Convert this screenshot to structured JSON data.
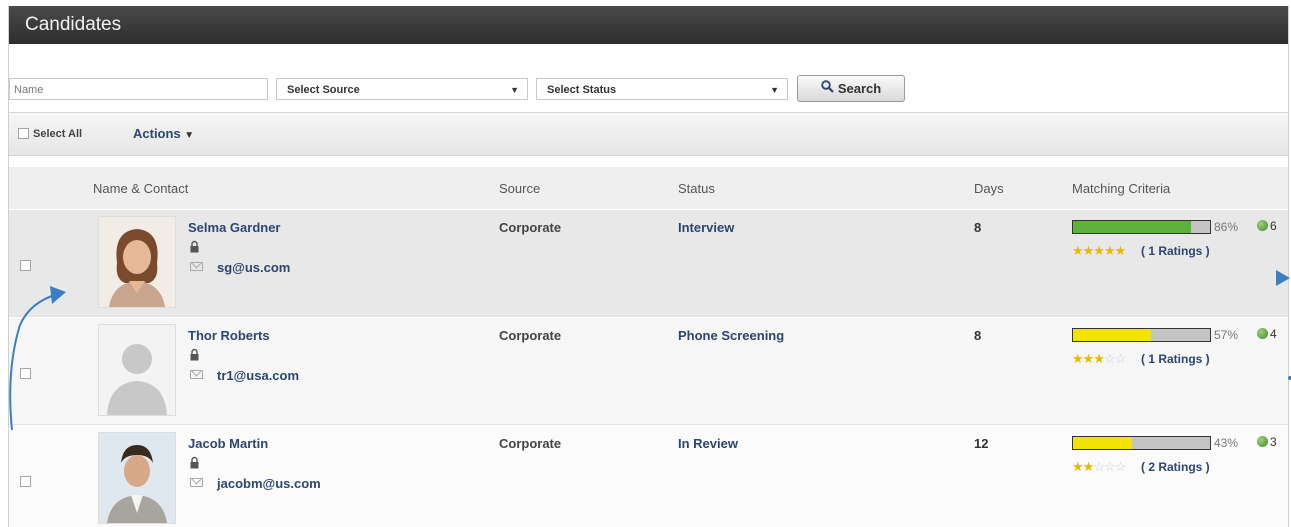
{
  "window": {
    "title": "Candidates"
  },
  "filters": {
    "name_placeholder": "Name",
    "source_value": "Select Source",
    "status_value": "Select Status",
    "search_label": "Search"
  },
  "toolbar": {
    "select_all_label": "Select All",
    "actions_label": "Actions"
  },
  "table": {
    "headers": {
      "name_contact": "Name & Contact",
      "source": "Source",
      "status": "Status",
      "days": "Days",
      "matching": "Matching Criteria"
    },
    "rows": [
      {
        "name": "Selma Gardner",
        "email": "sg@us.com",
        "source": "Corporate",
        "status": "Interview",
        "days": "8",
        "match_percent": 86,
        "match_label": "86%",
        "rating": 5,
        "ratings_label": "( 1 Ratings )",
        "info_count": "6"
      },
      {
        "name": "Thor Roberts",
        "email": "tr1@usa.com",
        "source": "Corporate",
        "status": "Phone Screening",
        "days": "8",
        "match_percent": 57,
        "match_label": "57%",
        "rating": 3,
        "ratings_label": "( 1 Ratings )",
        "info_count": "4"
      },
      {
        "name": "Jacob Martin",
        "email": "jacobm@us.com",
        "source": "Corporate",
        "status": "In Review",
        "days": "12",
        "match_percent": 43,
        "match_label": "43%",
        "rating": 2.5,
        "ratings_label": "( 2 Ratings )",
        "info_count": "3"
      }
    ]
  },
  "colors": {
    "match_high": "#5cb23a",
    "match_mid": "#f2e400",
    "annotation": "#3a7fc2"
  }
}
